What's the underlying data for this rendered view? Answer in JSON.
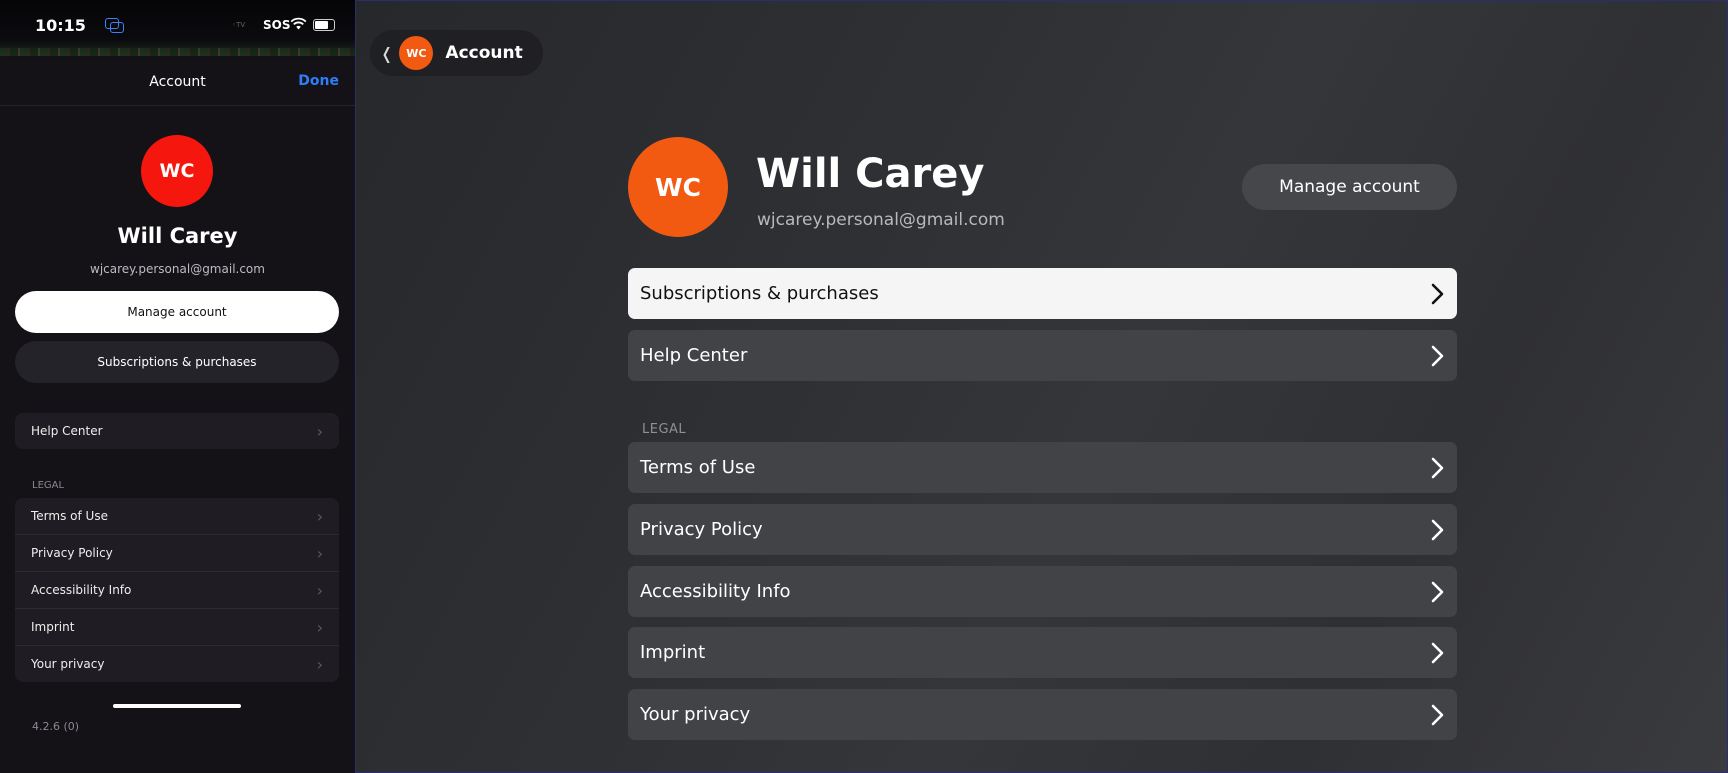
{
  "phone": {
    "status": {
      "time": "10:15",
      "carrier_indicator": "◦TV",
      "sos": "SOS"
    },
    "header": {
      "title": "Account",
      "done_label": "Done"
    },
    "profile": {
      "initials": "WC",
      "name": "Will Carey",
      "email": "wjcarey.personal@gmail.com"
    },
    "buttons": {
      "manage": "Manage account",
      "subscriptions": "Subscriptions & purchases"
    },
    "help": {
      "label": "Help Center"
    },
    "legal": {
      "section_label": "LEGAL",
      "items": [
        "Terms of Use",
        "Privacy Policy",
        "Accessibility Info",
        "Imprint",
        "Your privacy"
      ]
    },
    "version": "4.2.6 (0)",
    "colors": {
      "avatar": "#f5170e",
      "accent": "#2f7df7"
    }
  },
  "tv": {
    "back": {
      "initials": "WC",
      "label": "Account"
    },
    "profile": {
      "initials": "WC",
      "name": "Will Carey",
      "email": "wjcarey.personal@gmail.com"
    },
    "manage_label": "Manage account",
    "rows": {
      "subscriptions": "Subscriptions & purchases",
      "help": "Help Center"
    },
    "legal": {
      "section_label": "LEGAL",
      "items": [
        "Terms of Use",
        "Privacy Policy",
        "Accessibility Info",
        "Imprint",
        "Your privacy"
      ]
    },
    "focused_item": "Subscriptions & purchases",
    "colors": {
      "avatar": "#f25a12",
      "focus_bg": "#f5f5f6"
    }
  }
}
